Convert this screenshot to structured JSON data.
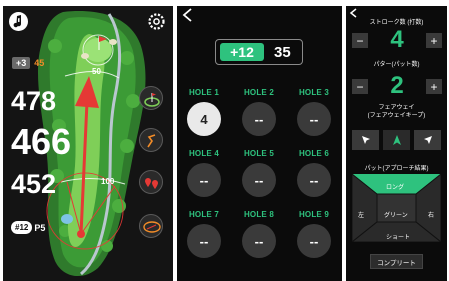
{
  "screen1": {
    "score_diff": "+3",
    "score_total": "45",
    "distances": [
      "478",
      "466",
      "452"
    ],
    "map_labels": [
      "50",
      "100"
    ],
    "hole_number": "#12",
    "par": "P5",
    "icons": [
      "music-note-icon",
      "settings-icon",
      "green-flag-icon",
      "dogleg-icon",
      "pin-markers-icon",
      "green-outline-icon"
    ],
    "colors": {
      "fairway": "#5ab33a",
      "rough": "#2d6e2a",
      "trees": "#3f8f3a",
      "arrow": "#e53935"
    }
  },
  "screen2": {
    "score_diff": "+12",
    "score_total": "35",
    "holes": [
      {
        "label": "HOLE 1",
        "value": "4"
      },
      {
        "label": "HOLE 2",
        "value": "--"
      },
      {
        "label": "HOLE 3",
        "value": "--"
      },
      {
        "label": "HOLE 4",
        "value": "--"
      },
      {
        "label": "HOLE 5",
        "value": "--"
      },
      {
        "label": "HOLE 6",
        "value": "--"
      },
      {
        "label": "HOLE 7",
        "value": "--"
      },
      {
        "label": "HOLE 8",
        "value": "--"
      },
      {
        "label": "HOLE 9",
        "value": "--"
      }
    ],
    "colors": {
      "accent": "#2ec27e"
    }
  },
  "screen3": {
    "stroke_label": "ストローク数 (打数)",
    "stroke_value": "4",
    "putter_label": "パター(パット数)",
    "putter_value": "2",
    "fairway_label_1": "フェアウェイ",
    "fairway_label_2": "(フェアウェイキープ)",
    "putt_label": "パット(アプローチ結果)",
    "approach": {
      "long": "ロング",
      "left": "左",
      "green": "グリーン",
      "right": "右",
      "short": "ショート"
    },
    "minus": "−",
    "plus": "+",
    "complete": "コンプリート"
  }
}
